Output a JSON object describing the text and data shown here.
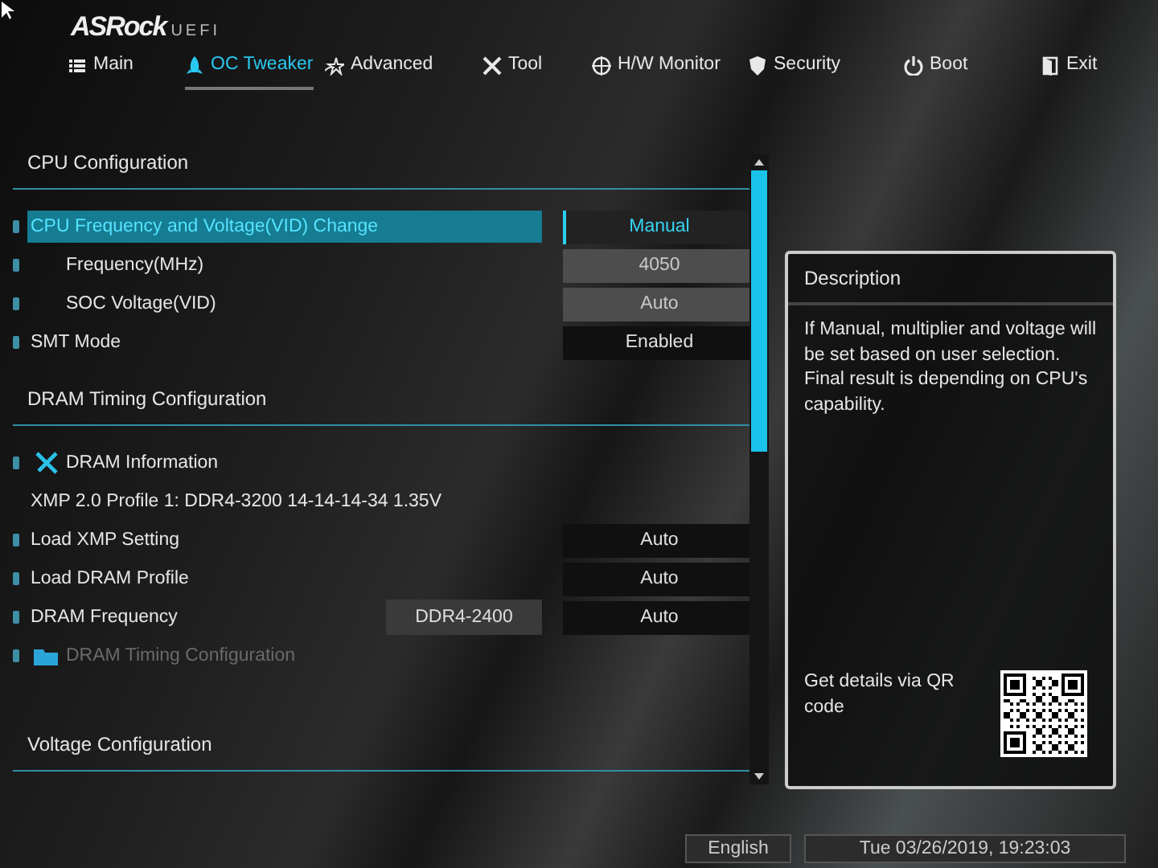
{
  "header": {
    "logo": "ASRock",
    "logo_suffix": "UEFI"
  },
  "tabs": [
    {
      "label": "Main",
      "selected": false
    },
    {
      "label": "OC Tweaker",
      "selected": true
    },
    {
      "label": "Advanced",
      "selected": false
    },
    {
      "label": "Tool",
      "selected": false
    },
    {
      "label": "H/W Monitor",
      "selected": false
    },
    {
      "label": "Security",
      "selected": false
    },
    {
      "label": "Boot",
      "selected": false
    },
    {
      "label": "Exit",
      "selected": false
    }
  ],
  "sections": [
    {
      "heading": "CPU Configuration",
      "items": [
        {
          "kind": "setting",
          "label": "CPU Frequency and Voltage(VID) Change",
          "value": "Manual",
          "selected": true,
          "disabled": false,
          "children": [
            {
              "kind": "setting",
              "label": "Frequency(MHz)",
              "value": "4050",
              "selected": false,
              "disabled": true
            },
            {
              "kind": "setting",
              "label": "SOC Voltage(VID)",
              "value": "Auto",
              "selected": false,
              "disabled": true
            }
          ]
        },
        {
          "kind": "setting",
          "label": "SMT Mode",
          "value": "Enabled",
          "selected": false,
          "disabled": false
        }
      ]
    },
    {
      "heading": "DRAM Timing Configuration",
      "items": [
        {
          "kind": "info",
          "label": "DRAM Information"
        },
        {
          "kind": "text",
          "label": "XMP 2.0 Profile 1: DDR4-3200 14-14-14-34 1.35V"
        },
        {
          "kind": "setting",
          "label": "Load XMP Setting",
          "value": "Auto",
          "selected": false,
          "disabled": false
        },
        {
          "kind": "setting",
          "label": "Load DRAM Profile",
          "value": "Auto",
          "selected": false,
          "disabled": false
        },
        {
          "kind": "setting",
          "label": "DRAM Frequency",
          "current": "DDR4-2400",
          "value": "Auto",
          "selected": false,
          "disabled": false
        },
        {
          "kind": "submenu",
          "label": "DRAM Timing Configuration",
          "disabled": true
        }
      ]
    },
    {
      "heading": "Voltage Configuration"
    }
  ],
  "description": {
    "title": "Description",
    "text": "If Manual, multiplier and voltage will be set based on user selection. Final result is depending on CPU's capability.",
    "qr_text": "Get details via QR code"
  },
  "footer": {
    "language": "English",
    "datetime": "Tue 03/26/2019, 19:23:03"
  }
}
